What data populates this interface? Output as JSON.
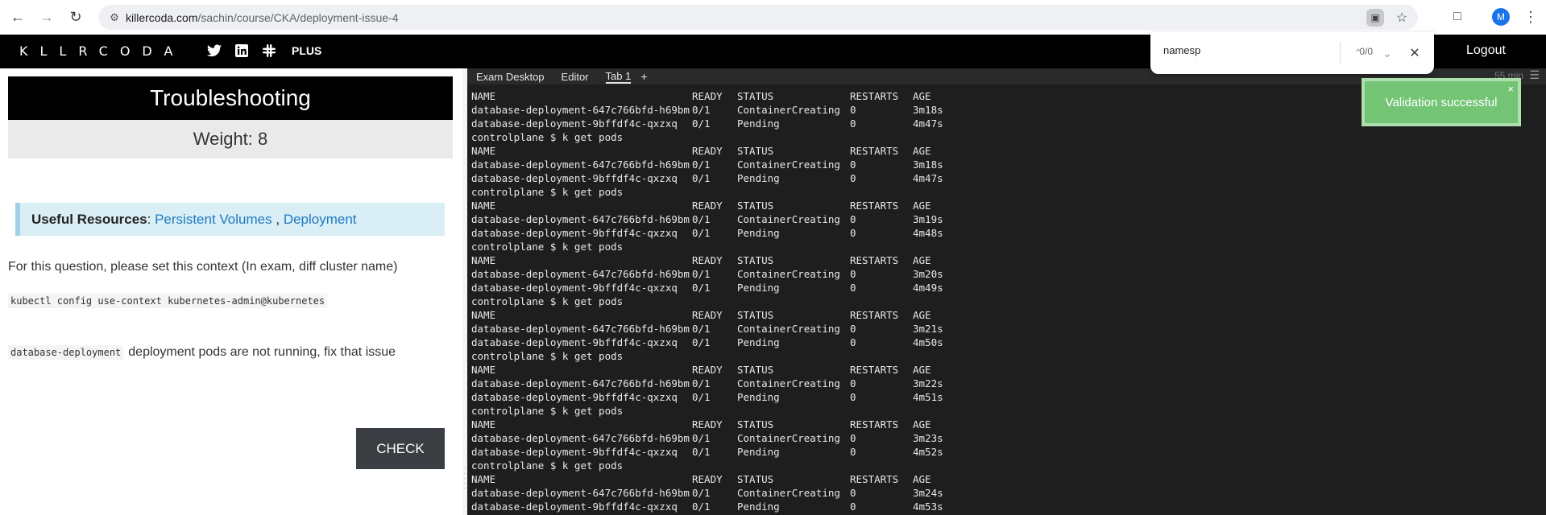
{
  "browser": {
    "url_host": "killercoda.com",
    "url_path": "/sachin/course/CKA/deployment-issue-4",
    "profile_initial": "M",
    "icons": [
      "back-icon",
      "forward-icon",
      "reload-icon",
      "site-info-icon",
      "page-action-icon",
      "bookmark-star-icon",
      "extensions-icon",
      "menu-dots-icon"
    ]
  },
  "header": {
    "logo": "KLLRCODA",
    "plus_label": "PLUS",
    "logout_label": "Logout",
    "icons": [
      "twitter-icon",
      "linkedin-icon",
      "slack-icon"
    ]
  },
  "find": {
    "query": "namesp",
    "count": "0/0"
  },
  "question": {
    "title": "Troubleshooting",
    "weight": "Weight: 8",
    "resources_label": "Useful Resources",
    "resources_sep": ":",
    "resource_link_1": "Persistent Volumes",
    "resource_link_comma": ",",
    "resource_link_2": "Deployment",
    "context_text": "For this question, please set this context (In exam, diff cluster name)",
    "context_cmd": "kubectl config use-context kubernetes-admin@kubernetes",
    "issue_code": "database-deployment",
    "issue_text": "deployment pods are not running, fix that issue",
    "check_label": "CHECK"
  },
  "terminal": {
    "tabs": [
      "Exam Desktop",
      "Editor",
      "Tab 1"
    ],
    "add_tab": "+",
    "timer": "55 min",
    "menu": "☰",
    "toast": "Validation successful",
    "toast_close": "×",
    "lines": [
      {
        "type": "header",
        "cols": [
          "NAME",
          "READY",
          "STATUS",
          "RESTARTS",
          "AGE"
        ]
      },
      {
        "type": "row",
        "cols": [
          "database-deployment-647c766bfd-h69bm",
          "0/1",
          "ContainerCreating",
          "0",
          "3m18s"
        ]
      },
      {
        "type": "row",
        "cols": [
          "database-deployment-9bffdf4c-qxzxq",
          "0/1",
          "Pending",
          "0",
          "4m47s"
        ]
      },
      {
        "type": "prompt",
        "text": "controlplane $ k get pods"
      },
      {
        "type": "header",
        "cols": [
          "NAME",
          "READY",
          "STATUS",
          "RESTARTS",
          "AGE"
        ]
      },
      {
        "type": "row",
        "cols": [
          "database-deployment-647c766bfd-h69bm",
          "0/1",
          "ContainerCreating",
          "0",
          "3m18s"
        ]
      },
      {
        "type": "row",
        "cols": [
          "database-deployment-9bffdf4c-qxzxq",
          "0/1",
          "Pending",
          "0",
          "4m47s"
        ]
      },
      {
        "type": "prompt",
        "text": "controlplane $ k get pods"
      },
      {
        "type": "header",
        "cols": [
          "NAME",
          "READY",
          "STATUS",
          "RESTARTS",
          "AGE"
        ]
      },
      {
        "type": "row",
        "cols": [
          "database-deployment-647c766bfd-h69bm",
          "0/1",
          "ContainerCreating",
          "0",
          "3m19s"
        ]
      },
      {
        "type": "row",
        "cols": [
          "database-deployment-9bffdf4c-qxzxq",
          "0/1",
          "Pending",
          "0",
          "4m48s"
        ]
      },
      {
        "type": "prompt",
        "text": "controlplane $ k get pods"
      },
      {
        "type": "header",
        "cols": [
          "NAME",
          "READY",
          "STATUS",
          "RESTARTS",
          "AGE"
        ]
      },
      {
        "type": "row",
        "cols": [
          "database-deployment-647c766bfd-h69bm",
          "0/1",
          "ContainerCreating",
          "0",
          "3m20s"
        ]
      },
      {
        "type": "row",
        "cols": [
          "database-deployment-9bffdf4c-qxzxq",
          "0/1",
          "Pending",
          "0",
          "4m49s"
        ]
      },
      {
        "type": "prompt",
        "text": "controlplane $ k get pods"
      },
      {
        "type": "header",
        "cols": [
          "NAME",
          "READY",
          "STATUS",
          "RESTARTS",
          "AGE"
        ]
      },
      {
        "type": "row",
        "cols": [
          "database-deployment-647c766bfd-h69bm",
          "0/1",
          "ContainerCreating",
          "0",
          "3m21s"
        ]
      },
      {
        "type": "row",
        "cols": [
          "database-deployment-9bffdf4c-qxzxq",
          "0/1",
          "Pending",
          "0",
          "4m50s"
        ]
      },
      {
        "type": "prompt",
        "text": "controlplane $ k get pods"
      },
      {
        "type": "header",
        "cols": [
          "NAME",
          "READY",
          "STATUS",
          "RESTARTS",
          "AGE"
        ]
      },
      {
        "type": "row",
        "cols": [
          "database-deployment-647c766bfd-h69bm",
          "0/1",
          "ContainerCreating",
          "0",
          "3m22s"
        ]
      },
      {
        "type": "row",
        "cols": [
          "database-deployment-9bffdf4c-qxzxq",
          "0/1",
          "Pending",
          "0",
          "4m51s"
        ]
      },
      {
        "type": "prompt",
        "text": "controlplane $ k get pods"
      },
      {
        "type": "header",
        "cols": [
          "NAME",
          "READY",
          "STATUS",
          "RESTARTS",
          "AGE"
        ]
      },
      {
        "type": "row",
        "cols": [
          "database-deployment-647c766bfd-h69bm",
          "0/1",
          "ContainerCreating",
          "0",
          "3m23s"
        ]
      },
      {
        "type": "row",
        "cols": [
          "database-deployment-9bffdf4c-qxzxq",
          "0/1",
          "Pending",
          "0",
          "4m52s"
        ]
      },
      {
        "type": "prompt",
        "text": "controlplane $ k get pods"
      },
      {
        "type": "header",
        "cols": [
          "NAME",
          "READY",
          "STATUS",
          "RESTARTS",
          "AGE"
        ]
      },
      {
        "type": "row",
        "cols": [
          "database-deployment-647c766bfd-h69bm",
          "0/1",
          "ContainerCreating",
          "0",
          "3m24s"
        ]
      },
      {
        "type": "row",
        "cols": [
          "database-deployment-9bffdf4c-qxzxq",
          "0/1",
          "Pending",
          "0",
          "4m53s"
        ]
      }
    ]
  },
  "colors": {
    "header_bg": "#000000",
    "terminal_bg": "#1e1e1e",
    "link": "#1e7ac2",
    "toast_bg": "#74c476",
    "check_bg": "#3a3d42"
  }
}
